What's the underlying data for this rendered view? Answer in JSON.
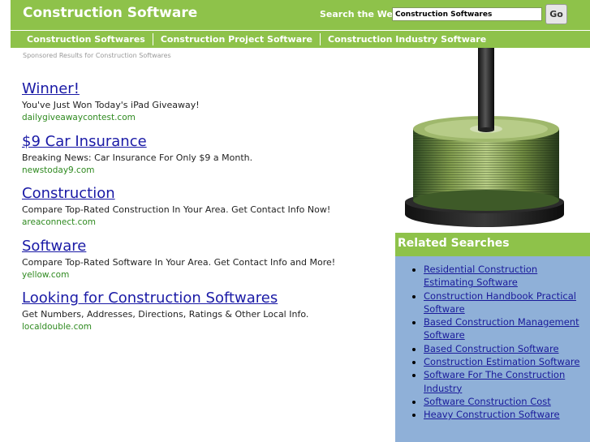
{
  "header": {
    "site_title": "Construction Software",
    "search_label": "Search the Web:",
    "search_value": "Construction Softwares",
    "go_label": "Go"
  },
  "nav": {
    "items": [
      {
        "label": "Construction Softwares"
      },
      {
        "label": "Construction Project Software"
      },
      {
        "label": "Construction Industry Software"
      }
    ]
  },
  "sponsored_label": "Sponsored Results for Construction Softwares",
  "ads": [
    {
      "title": "Winner!",
      "description": "You've Just Won Today's iPad Giveaway!",
      "url": "dailygiveawaycontest.com"
    },
    {
      "title": "$9 Car Insurance",
      "description": "Breaking News: Car Insurance For Only $9 a Month.",
      "url": "newstoday9.com"
    },
    {
      "title": "Construction",
      "description": "Compare Top-Rated Construction In Your Area. Get Contact Info Now!",
      "url": "areaconnect.com"
    },
    {
      "title": "Software",
      "description": "Compare Top-Rated Software In Your Area. Get Contact Info and More!",
      "url": "yellow.com"
    },
    {
      "title": "Looking for Construction Softwares",
      "description": "Get Numbers, Addresses, Directions, Ratings & Other Local Info.",
      "url": "localdouble.com"
    }
  ],
  "related": {
    "title": "Related Searches",
    "items": [
      {
        "label": "Residential Construction Estimating Software"
      },
      {
        "label": "Construction Handbook Practical Software"
      },
      {
        "label": "Based Construction Management Software"
      },
      {
        "label": "Based Construction Software"
      },
      {
        "label": "Construction Estimation Software"
      },
      {
        "label": "Software For The Construction Industry"
      },
      {
        "label": "Software Construction Cost"
      },
      {
        "label": "Heavy Construction Software"
      }
    ]
  },
  "colors": {
    "brand_green": "#8ec24a",
    "related_blue": "#8fb0d8",
    "link_blue": "#1a1aa6",
    "url_green": "#2f8a20"
  }
}
